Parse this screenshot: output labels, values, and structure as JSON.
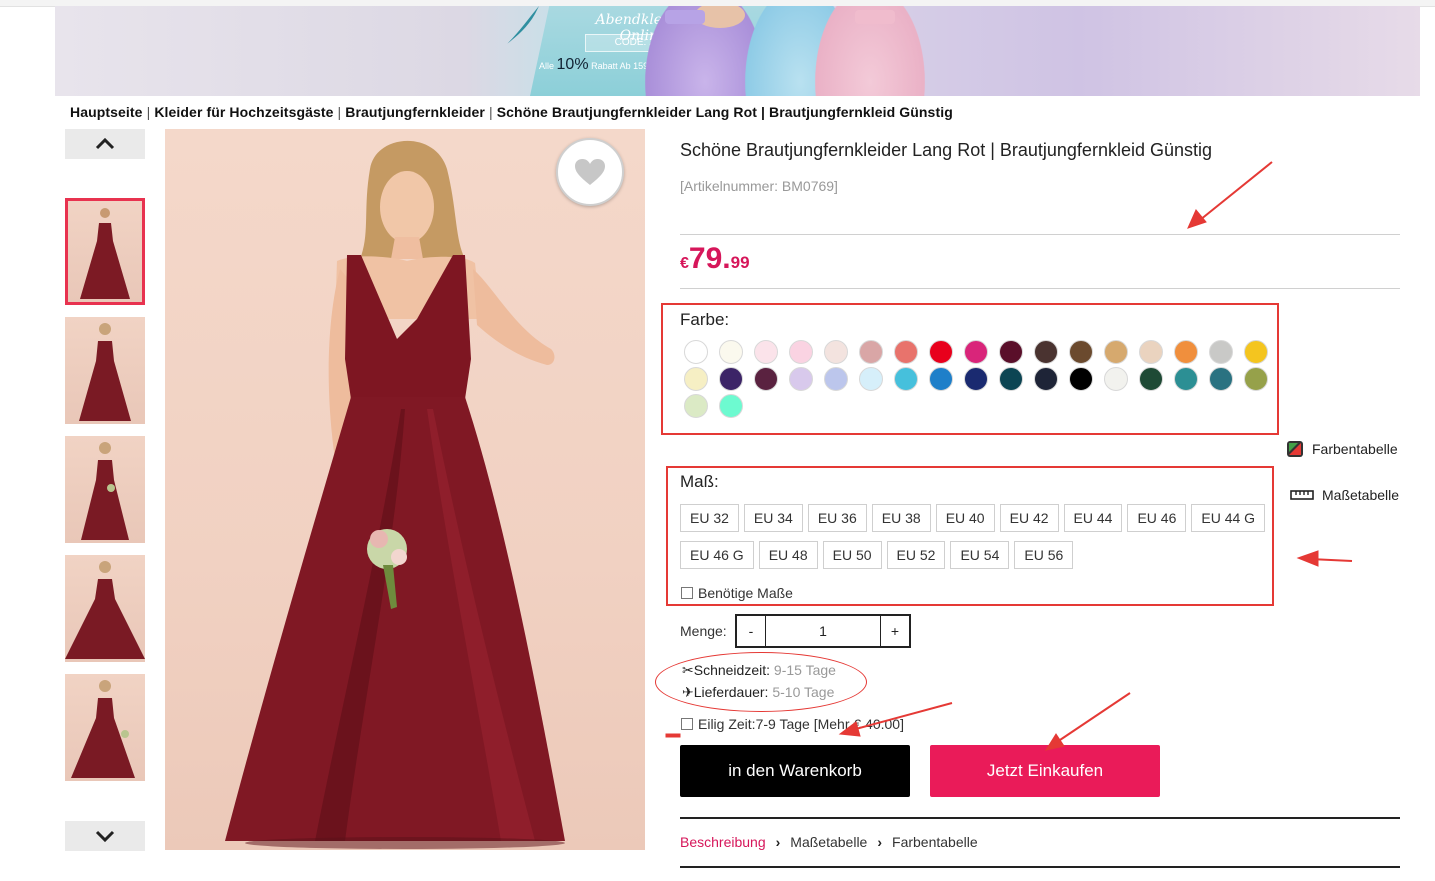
{
  "banner": {
    "script_text": "Abendkleider Online",
    "code_text": "CODE: 2023",
    "discount_prefix": "Alle",
    "discount_value": "10%",
    "discount_suffix": "Rabatt Ab 159 EUR"
  },
  "breadcrumb": {
    "items": [
      "Hauptseite",
      "Kleider für Hochzeitsgäste",
      "Brautjungfernkleider",
      "Schöne Brautjungfernkleider Lang Rot | Brautjungfernkleid Günstig"
    ],
    "separator": "|"
  },
  "gallery": {
    "up_icon": "chevron-up-icon",
    "down_icon": "chevron-down-icon",
    "active_index": 0,
    "thumbnail_count": 5
  },
  "product": {
    "title": "Schöne Brautjungfernkleider Lang Rot | Brautjungfernkleid Günstig",
    "sku": "[Artikelnummer: BM0769]",
    "price_currency": "€",
    "price_int": "79.",
    "price_dec": "99",
    "price_color": "#d6165a"
  },
  "color": {
    "label": "Farbe:",
    "swatches": [
      "#ffffff",
      "#fbf9ee",
      "#fbe3ea",
      "#fad3e2",
      "#f3e3df",
      "#d9a6a6",
      "#e8736c",
      "#e8001c",
      "#d9257a",
      "#5a0f2a",
      "#4a3330",
      "#6b4a2e",
      "#d6a96e",
      "#ead3bf",
      "#f08f3d",
      "#c9c9c7",
      "#f4c51f",
      "#f6efc4",
      "#3c2467",
      "#5a2240",
      "#d8c9ec",
      "#bcc6ec",
      "#d6effa",
      "#46c0dc",
      "#1e7fc9",
      "#1a2a70",
      "#0c4553",
      "#1e2437",
      "#000000",
      "#f2f2ee",
      "#1e4a35",
      "#2c8f94",
      "#2a7281",
      "#96a14a",
      "#dbeac5",
      "#6dfad0"
    ]
  },
  "links": {
    "color_chart": "Farbentabelle",
    "size_chart": "Maßetabelle"
  },
  "size": {
    "label": "Maß:",
    "row1": [
      "EU 32",
      "EU 34",
      "EU 36",
      "EU 38",
      "EU 40",
      "EU 42",
      "EU 44",
      "EU 46",
      "EU 44 G"
    ],
    "row2": [
      "EU 46 G",
      "EU 48",
      "EU 50",
      "EU 52",
      "EU 54",
      "EU 56"
    ],
    "needs_label": "Benötige Maße"
  },
  "quantity": {
    "label": "Menge:",
    "minus": "-",
    "value": "1",
    "plus": "+"
  },
  "delivery": {
    "cut_label": "Schneidzeit:",
    "cut_value": " 9-15 Tage",
    "ship_label": "Lieferdauer:",
    "ship_value": " 5-10 Tage",
    "express_label": "Eilig Zeit:7-9 Tage [Mehr € 40.00]"
  },
  "actions": {
    "cart": "in den Warenkorb",
    "buy": "Jetzt Einkaufen"
  },
  "tabs": {
    "items": [
      "Beschreibung",
      "Maßetabelle",
      "Farbentabelle"
    ],
    "active_index": 0
  }
}
